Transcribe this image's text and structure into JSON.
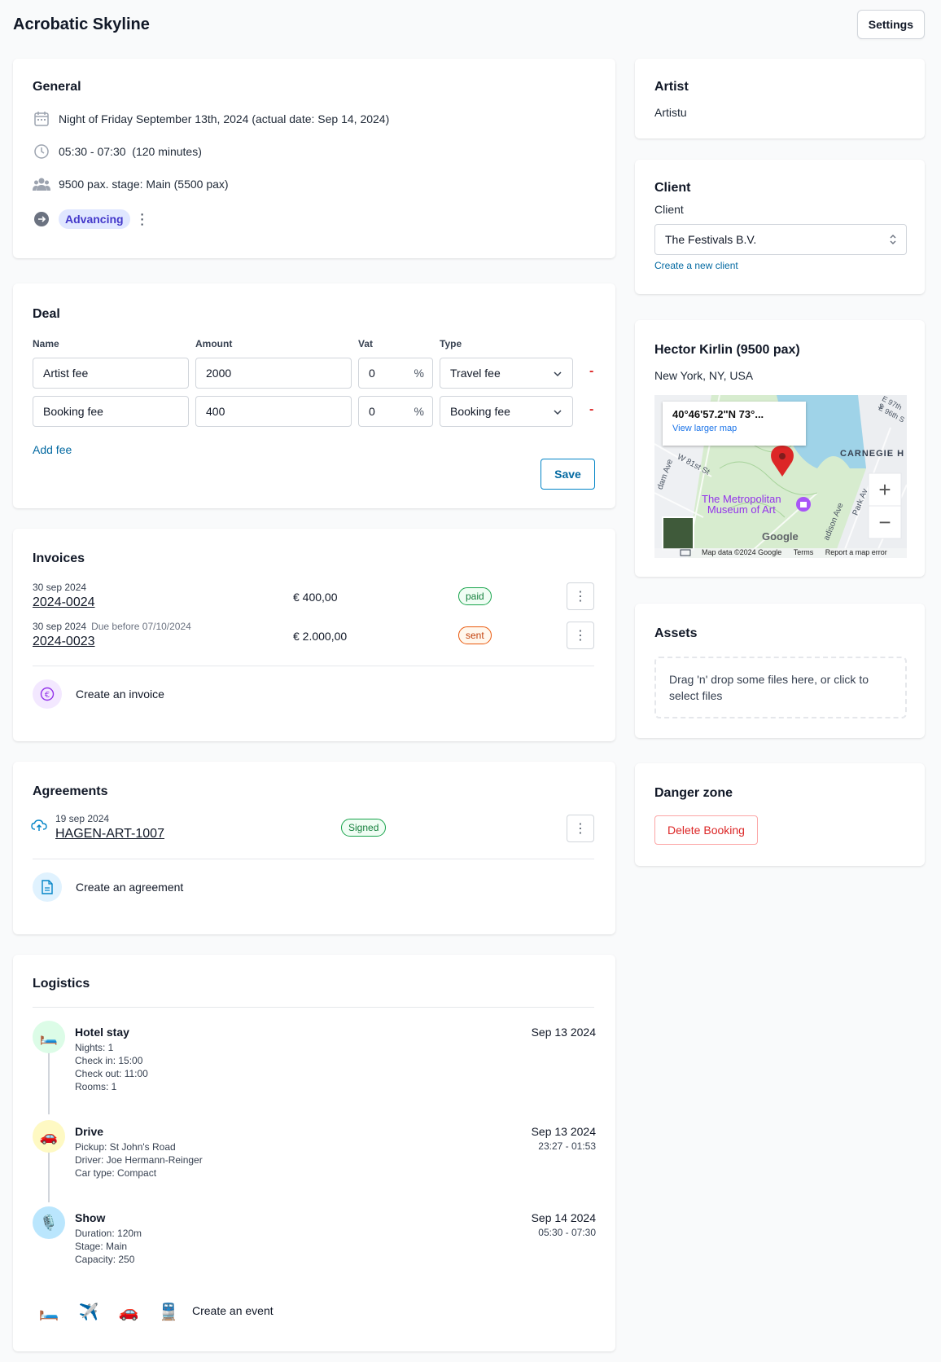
{
  "app": {
    "title": "Acrobatic Skyline",
    "settings_label": "Settings"
  },
  "general": {
    "title": "General",
    "date": "Night of Friday September 13th, 2024 (actual date: Sep 14, 2024)",
    "time": "05:30 - 07:30  (120 minutes)",
    "capacity": "9500 pax. stage: Main (5500 pax)",
    "status": "Advancing"
  },
  "deal": {
    "title": "Deal",
    "headers": {
      "name": "Name",
      "amount": "Amount",
      "vat": "Vat",
      "type": "Type"
    },
    "fees": [
      {
        "name": "Artist fee",
        "amount": "2000",
        "vat": "0",
        "type": "Travel fee"
      },
      {
        "name": "Booking fee",
        "amount": "400",
        "vat": "0",
        "type": "Booking fee"
      }
    ],
    "pct": "%",
    "remove": "-",
    "add_label": "Add fee",
    "save_label": "Save"
  },
  "invoices": {
    "title": "Invoices",
    "items": [
      {
        "date": "30 sep 2024",
        "due": "",
        "number": "2024-0024",
        "amount": "€ 400,00",
        "status": "paid"
      },
      {
        "date": "30 sep 2024",
        "due": "Due before 07/10/2024",
        "number": "2024-0023",
        "amount": "€ 2.000,00",
        "status": "sent"
      }
    ],
    "create_label": "Create an invoice"
  },
  "agreements": {
    "title": "Agreements",
    "items": [
      {
        "date": "19 sep 2024",
        "number": "HAGEN-ART-1007",
        "status": "Signed"
      }
    ],
    "create_label": "Create an agreement"
  },
  "logistics": {
    "title": "Logistics",
    "events": [
      {
        "icon": "bed-icon",
        "emoji": "🛏️",
        "title": "Hotel stay",
        "lines": [
          "Nights: 1",
          "Check in: 15:00",
          "Check out: 11:00",
          "Rooms: 1"
        ],
        "date": "Sep 13 2024",
        "time": ""
      },
      {
        "icon": "car-icon",
        "emoji": "🚗",
        "title": "Drive",
        "lines": [
          "Pickup: St John's Road",
          "Driver: Joe Hermann-Reinger",
          "Car type: Compact"
        ],
        "date": "Sep 13 2024",
        "time": "23:27 - 01:53"
      },
      {
        "icon": "microphone-icon",
        "emoji": "🎙️",
        "title": "Show",
        "lines": [
          "Duration: 120m",
          "Stage: Main",
          "Capacity: 250"
        ],
        "date": "Sep 14 2024",
        "time": "05:30 - 07:30"
      }
    ],
    "quick_icons": [
      {
        "name": "bed-icon",
        "emoji": "🛏️"
      },
      {
        "name": "plane-icon",
        "emoji": "✈️"
      },
      {
        "name": "car-icon",
        "emoji": "🚗"
      },
      {
        "name": "train-icon",
        "emoji": "🚆"
      }
    ],
    "create_label": "Create an event"
  },
  "artist": {
    "title": "Artist",
    "name": "Artistu"
  },
  "client": {
    "title": "Client",
    "label": "Client",
    "value": "The Festivals B.V.",
    "create_label": "Create a new client"
  },
  "venue": {
    "title": "Hector Kirlin (9500 pax)",
    "location": "New York, NY, USA",
    "map": {
      "coords": "40°46'57.2\"N 73°...",
      "larger_map": "View larger map",
      "poi": "The Metropolitan Museum of Art",
      "poi_line1": "The Metropolitan",
      "poi_line2": "Museum of Art",
      "area_label": "CARNEGIE H",
      "street1": "W 81st St",
      "street2": "Park Av",
      "street3": "adison Ave",
      "street4": "dam Ave",
      "street5": "E 97th S",
      "street6": "E 96th S",
      "brand": "Google",
      "attribution": "Map data ©2024 Google",
      "terms": "Terms",
      "report": "Report a map error",
      "zoom_in": "+",
      "zoom_out": "−"
    }
  },
  "assets": {
    "title": "Assets",
    "dropzone": "Drag 'n' drop some files here, or click to select files"
  },
  "danger": {
    "title": "Danger zone",
    "delete_label": "Delete Booking"
  },
  "colors": {
    "accent": "#0369a1",
    "danger": "#dc2626",
    "badge_bg": "#e0e7ff",
    "badge_fg": "#4338ca"
  }
}
